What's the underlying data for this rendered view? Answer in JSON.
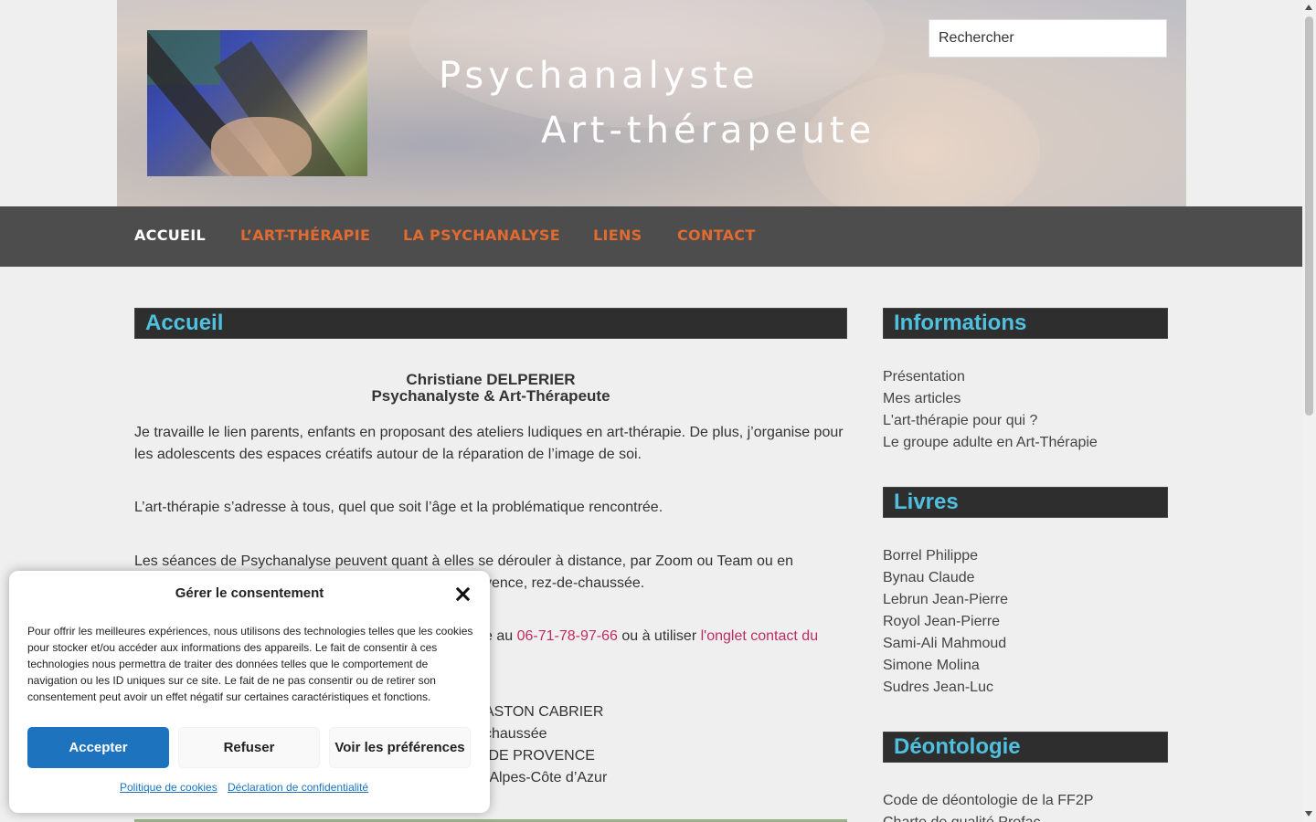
{
  "header": {
    "title_line1": "Psychanalyste",
    "title_line2": "Art-thérapeute",
    "search_placeholder": "Rechercher"
  },
  "nav": {
    "items": [
      {
        "label": "Accueil",
        "active": true
      },
      {
        "label": "L’art-thérapie",
        "active": false
      },
      {
        "label": "La Psychanalyse",
        "active": false
      },
      {
        "label": "Liens",
        "active": false
      },
      {
        "label": "Contact",
        "active": false
      }
    ]
  },
  "main": {
    "heading": "Accueil",
    "name": "Christiane DELPERIER",
    "subtitle": "Psychanalyste & Art-Thérapeute",
    "para1": "Je travaille le lien parents, enfants en proposant des ateliers ludiques en art-thérapie. De plus, j’organise pour les adolescents des espaces créatifs autour de la réparation de l’image de soi.",
    "para2": "L’art-thérapie s’adresse à tous, quel que soit l’âge et la problématique rencontrée.",
    "para3_line1": "Les séances de Psychanalyse peuvent quant à elles se dérouler à distance, par Zoom ou Team ou en",
    "para3_line2_tail": "vence, rez-de-chaussée.",
    "contact_prefix": "e au ",
    "phone": "06-71-78-97-66",
    "contact_middle": " ou à utiliser ",
    "contact_link": "l'onglet contact du",
    "address_line1": "ASTON CABRIER",
    "address_line2": "chaussée",
    "address_line3": " DE PROVENCE",
    "address_line4": "-Alpes-Côte d’Azur"
  },
  "sidebar": {
    "informations": {
      "heading": "Informations",
      "items": [
        "Présentation",
        "Mes articles",
        "L'art-thérapie pour qui ?",
        "Le groupe adulte en Art-Thérapie"
      ]
    },
    "livres": {
      "heading": "Livres",
      "items": [
        "Borrel Philippe",
        "Bynau Claude",
        "Lebrun Jean-Pierre",
        "Royol Jean-Pierre",
        "Sami-Ali Mahmoud",
        "Simone Molina",
        "Sudres Jean-Luc"
      ]
    },
    "deontologie": {
      "heading": "Déontologie",
      "items": [
        "Code de déontologie de la FF2P",
        "Charte de qualité Profac"
      ]
    }
  },
  "consent": {
    "title": "Gérer le consentement",
    "message": "Pour offrir les meilleures expériences, nous utilisons des technologies telles que les cookies pour stocker et/ou accéder aux informations des appareils. Le fait de consentir à ces technologies nous permettra de traiter des données telles que le comportement de navigation ou les ID uniques sur ce site. Le fait de ne pas consentir ou de retirer son consentement peut avoir un effet négatif sur certaines caractéristiques et fonctions.",
    "accept": "Accepter",
    "refuse": "Refuser",
    "preferences": "Voir les préférences",
    "cookie_policy": "Politique de cookies",
    "privacy": "Déclaration de confidentialité"
  },
  "colors": {
    "nav_bg": "#4d4d4d",
    "nav_link": "#e06a30",
    "heading_text": "#4fc0dd",
    "link": "#c02c62",
    "accept_bg": "#1e73be"
  }
}
